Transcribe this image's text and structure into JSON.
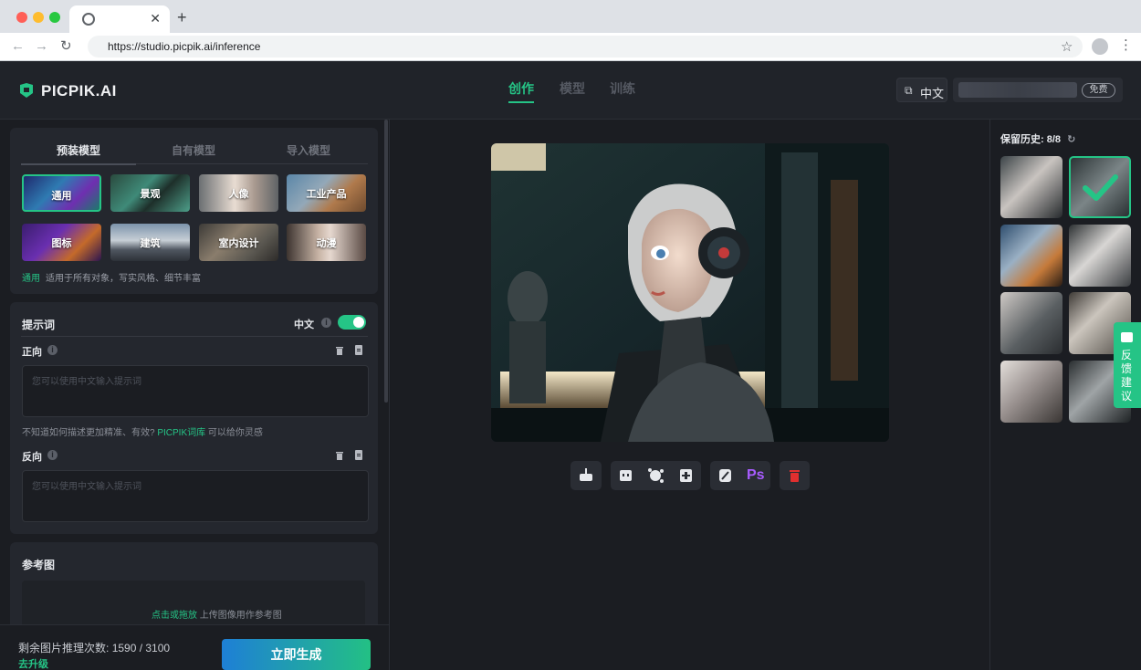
{
  "browser": {
    "url": "https://studio.picpik.ai/inference",
    "traffic_colors": [
      "#ff5f57",
      "#febc2e",
      "#28c840"
    ]
  },
  "header": {
    "logo_text": "PICPIK.AI",
    "nav": [
      {
        "label": "创作",
        "active": true
      },
      {
        "label": "模型",
        "active": false
      },
      {
        "label": "训练",
        "active": false
      }
    ],
    "language": "中文",
    "plan_badge": "免费"
  },
  "model_panel": {
    "tabs": [
      "预装模型",
      "自有模型",
      "导入模型"
    ],
    "tiles": [
      {
        "label": "通用",
        "selected": true
      },
      {
        "label": "景观",
        "selected": false
      },
      {
        "label": "人像",
        "selected": false
      },
      {
        "label": "工业产品",
        "selected": false
      },
      {
        "label": "图标",
        "selected": false
      },
      {
        "label": "建筑",
        "selected": false
      },
      {
        "label": "室内设计",
        "selected": false
      },
      {
        "label": "动漫",
        "selected": false
      }
    ],
    "desc_highlight": "通用",
    "desc_text": "适用于所有对象，写实风格、细节丰富"
  },
  "prompt": {
    "title": "提示词",
    "toggle_label": "中文",
    "toggle_on": true,
    "positive_label": "正向",
    "positive_placeholder": "您可以使用中文输入提示词",
    "hint_pre": "不知道如何描述更加精准、有效?",
    "hint_link": "PICPIK词库",
    "hint_post": "可以给你灵感",
    "negative_label": "反向",
    "negative_placeholder": "您可以使用中文输入提示词"
  },
  "reference": {
    "title": "参考图",
    "upload_link": "点击或拖放",
    "upload_text": "上传图像用作参考图"
  },
  "footer": {
    "remaining_label": "剩余图片推理次数:",
    "remaining_value": "1590 / 3100",
    "upgrade": "去升级",
    "generate": "立即生成"
  },
  "toolbar": {
    "ps_label": "Ps",
    "icons": [
      "download-icon",
      "quote-icon",
      "face-enhance-icon",
      "upscale-icon",
      "edit-image-icon",
      "photoshop-icon",
      "delete-icon"
    ]
  },
  "history": {
    "label": "保留历史:",
    "count": "8/8",
    "selected_index": 1
  },
  "feedback": {
    "label": "反馈建议"
  },
  "colors": {
    "accent": "#25c486",
    "danger": "#e02f2f",
    "ps_purple": "#a85cff"
  }
}
